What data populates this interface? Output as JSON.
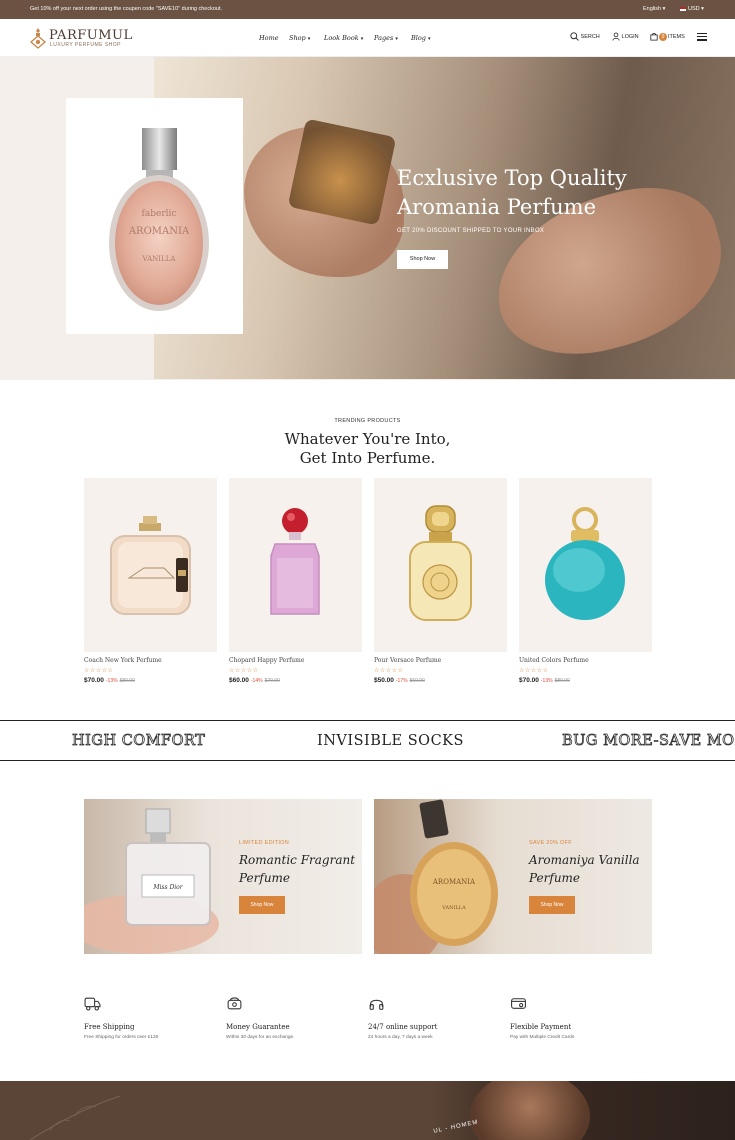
{
  "topbar": {
    "promo": "Get 10% off your next order using the coupen code \"SAVE10\" during checkout.",
    "language": "English",
    "currency": "USD"
  },
  "header": {
    "brand": "PARFUMUL",
    "tagline": "LUXURY PERFUME SHOP",
    "nav": [
      "Home",
      "Shop",
      "Look Book",
      "Pages",
      "Blog"
    ],
    "search": "SERCH",
    "login": "LOGIN",
    "cart_count": "0",
    "cart_label": "ITEMS"
  },
  "hero": {
    "title_line1": "Ecxlusive Top Quality",
    "title_line2": "Aromania Perfume",
    "subtitle": "GET 20% DISCOUNT SHIPPED TO YOUR INBOX",
    "button": "Shop Now",
    "bottle_text": [
      "faberlic",
      "AROMANIA",
      "VANILLA"
    ]
  },
  "trending": {
    "label": "TRENDING PRODUCTS",
    "title_line1": "Whatever You're Into,",
    "title_line2": "Get Into Perfume.",
    "products": [
      {
        "name": "Coach New York Perfume",
        "price": "$70.00",
        "discount": "-13%",
        "old_price": "$80.00",
        "stars": "☆☆☆☆☆"
      },
      {
        "name": "Chopard Happy Perfume",
        "price": "$60.00",
        "discount": "-14%",
        "old_price": "$70.00",
        "stars": "☆☆☆☆☆"
      },
      {
        "name": "Pour Versace Perfume",
        "price": "$50.00",
        "discount": "-17%",
        "old_price": "$60.00",
        "stars": "☆☆☆☆☆"
      },
      {
        "name": "United Colors Perfume",
        "price": "$70.00",
        "discount": "-13%",
        "old_price": "$80.00",
        "stars": "☆☆☆☆☆"
      }
    ]
  },
  "marquee": [
    "HIGH COMFORT",
    "INVISIBLE SOCKS",
    "BUG MORE-SAVE MORE"
  ],
  "banners": [
    {
      "tag": "LIMITED EDITION",
      "title_line1": "Romantic Fragrant",
      "title_line2": "Perfume",
      "button": "Shop Now"
    },
    {
      "tag": "SAVE 20% OFF",
      "title_line1": "Aromaniya Vanilla",
      "title_line2": "Perfume",
      "button": "Shop Now"
    }
  ],
  "features": [
    {
      "icon": "truck-icon",
      "title": "Free Shipping",
      "desc": "Free Shipping for orders over £130"
    },
    {
      "icon": "money-icon",
      "title": "Money Guarantee",
      "desc": "Within 30 days for an exchange."
    },
    {
      "icon": "headphones-icon",
      "title": "24/7 online support",
      "desc": "24 hours a day, 7 days a week"
    },
    {
      "icon": "card-icon",
      "title": "Flexible Payment",
      "desc": "Pay with Multiple Credit Cards"
    }
  ],
  "footer": {
    "curved_text": "UL - HOMEM"
  },
  "colors": {
    "brown": "#6b5243",
    "accent": "#d9843b",
    "sale": "#e04a3a"
  }
}
